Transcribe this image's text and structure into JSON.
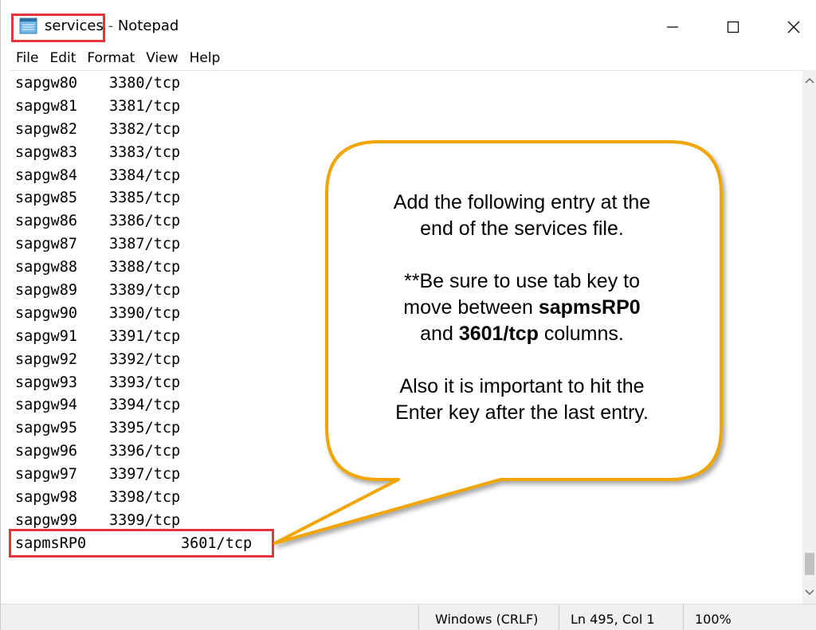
{
  "window": {
    "file_name": "services",
    "separator": "-",
    "app_name": "Notepad",
    "controls": {
      "minimize_icon": "minimize-icon",
      "maximize_icon": "maximize-icon",
      "close_icon": "close-icon"
    }
  },
  "menu": [
    "File",
    "Edit",
    "Format",
    "View",
    "Help"
  ],
  "lines": [
    {
      "name": "sapgw80",
      "port": "3380/tcp"
    },
    {
      "name": "sapgw81",
      "port": "3381/tcp"
    },
    {
      "name": "sapgw82",
      "port": "3382/tcp"
    },
    {
      "name": "sapgw83",
      "port": "3383/tcp"
    },
    {
      "name": "sapgw84",
      "port": "3384/tcp"
    },
    {
      "name": "sapgw85",
      "port": "3385/tcp"
    },
    {
      "name": "sapgw86",
      "port": "3386/tcp"
    },
    {
      "name": "sapgw87",
      "port": "3387/tcp"
    },
    {
      "name": "sapgw88",
      "port": "3388/tcp"
    },
    {
      "name": "sapgw89",
      "port": "3389/tcp"
    },
    {
      "name": "sapgw90",
      "port": "3390/tcp"
    },
    {
      "name": "sapgw91",
      "port": "3391/tcp"
    },
    {
      "name": "sapgw92",
      "port": "3392/tcp"
    },
    {
      "name": "sapgw93",
      "port": "3393/tcp"
    },
    {
      "name": "sapgw94",
      "port": "3394/tcp"
    },
    {
      "name": "sapgw95",
      "port": "3395/tcp"
    },
    {
      "name": "sapgw96",
      "port": "3396/tcp"
    },
    {
      "name": "sapgw97",
      "port": "3397/tcp"
    },
    {
      "name": "sapgw98",
      "port": "3398/tcp"
    },
    {
      "name": "sapgw99",
      "port": "3399/tcp"
    }
  ],
  "last_entry": {
    "name": "sapmsRP0",
    "port": "3601/tcp"
  },
  "status": {
    "encoding": "Windows (CRLF)",
    "position": "Ln 495, Col 1",
    "zoom": "100%"
  },
  "callout": {
    "line1": "Add the following entry at the",
    "line2": "end of the services file.",
    "line3": "**Be sure to use tab key to",
    "line4_prefix": "move between ",
    "line4_bold": "sapmsRP0",
    "line5_prefix": "and ",
    "line5_bold": "3601/tcp",
    "line5_suffix": " columns.",
    "line6": "Also it is important to hit the",
    "line7": "Enter key after the last entry.",
    "border_color": "#f0a500"
  },
  "highlight_color": "#e5343b"
}
